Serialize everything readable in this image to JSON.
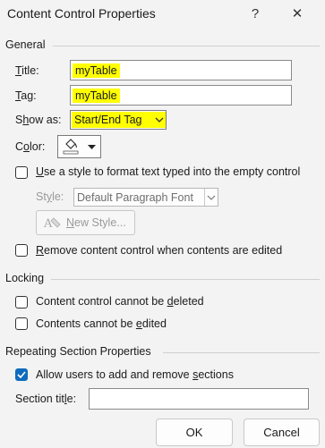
{
  "window": {
    "title": "Content Control Properties",
    "help": "?",
    "close": "✕"
  },
  "general": {
    "header": "General",
    "title_label_key": "T",
    "title_label_rest": "itle:",
    "title_value": "myTable",
    "tag_label_key": "T",
    "tag_label_rest": "ag:",
    "tag_value": "myTable",
    "showas_label_pre": "S",
    "showas_label_key": "h",
    "showas_label_rest": "ow as:",
    "showas_value": "Start/End Tag",
    "color_label_pre": "C",
    "color_label_key": "o",
    "color_label_rest": "lor:",
    "use_style_key": "U",
    "use_style_rest": "se a style to format text typed into the empty control",
    "use_style_checked": false,
    "style_label_pre": "St",
    "style_label_key": "y",
    "style_label_rest": "le:",
    "style_value": "Default Paragraph Font",
    "new_style_key": "N",
    "new_style_rest": "ew Style...",
    "remove_key": "R",
    "remove_rest": "emove content control when contents are edited",
    "remove_checked": false
  },
  "locking": {
    "header": "Locking",
    "cannot_delete_pre": "Content control cannot be ",
    "cannot_delete_key": "d",
    "cannot_delete_rest": "eleted",
    "cannot_delete_checked": false,
    "cannot_edit_pre": "Contents cannot be ",
    "cannot_edit_key": "e",
    "cannot_edit_rest": "dited",
    "cannot_edit_checked": false
  },
  "repeating": {
    "header": "Repeating Section Properties",
    "allow_pre": "Allow users to add and remove ",
    "allow_key": "s",
    "allow_rest": "ections",
    "allow_checked": true,
    "section_title_pre": "Section tit",
    "section_title_key": "l",
    "section_title_rest": "e:",
    "section_title_value": ""
  },
  "buttons": {
    "ok": "OK",
    "cancel": "Cancel"
  },
  "colors": {
    "highlight": "#ffff00",
    "accent": "#0f6cbd",
    "window_bg": "#f3f3f3"
  },
  "icons": {
    "color_picker": "paint-bucket-icon",
    "new_style": "new-style-icon",
    "dropdown": "chevron-down-icon",
    "check": "checkmark-icon"
  }
}
